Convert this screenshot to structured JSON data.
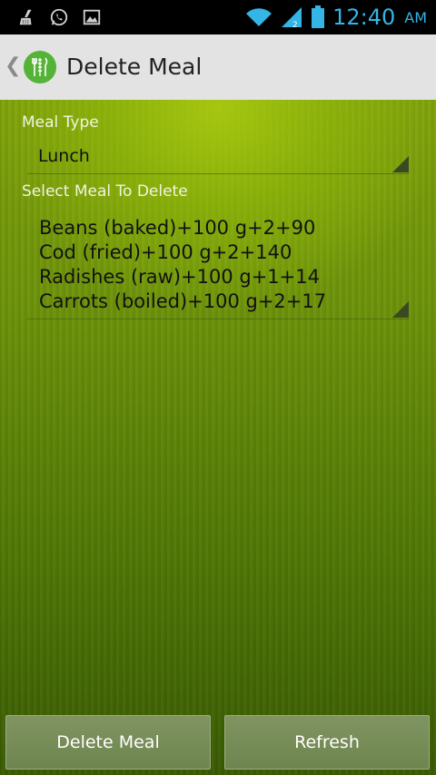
{
  "status_bar": {
    "time": "12:40",
    "ampm": "AM",
    "accent_color": "#33b5e5",
    "left_icons": [
      "cleaner-icon",
      "whatsapp-icon",
      "image-icon"
    ],
    "right_icons": [
      "wifi-icon",
      "signal-icon",
      "battery-icon"
    ]
  },
  "action_bar": {
    "title": "Delete Meal",
    "up_glyph": "❮"
  },
  "form": {
    "meal_type_label": "Meal Type",
    "meal_type_value": "Lunch",
    "select_label": "Select Meal To Delete",
    "meals": [
      "Beans (baked)+100 g+2+90",
      "Cod (fried)+100 g+2+140",
      "Radishes (raw)+100 g+1+14",
      "Carrots (boiled)+100 g+2+17"
    ]
  },
  "buttons": {
    "delete_label": "Delete Meal",
    "refresh_label": "Refresh"
  }
}
